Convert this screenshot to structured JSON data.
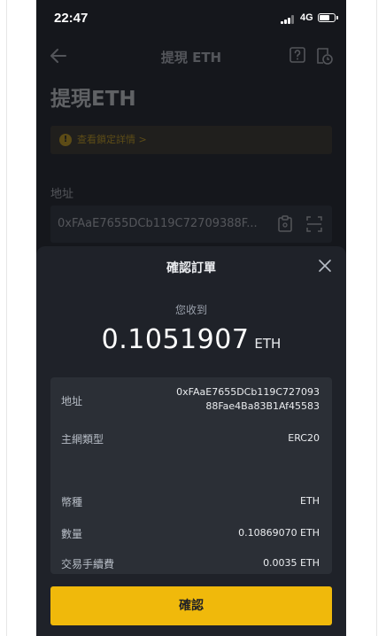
{
  "status_bar": {
    "time": "22:47",
    "network": "4G"
  },
  "background_screen": {
    "nav_title": "提現 ETH",
    "heading": "提現ETH",
    "notice": "查看鎖定詳情 >",
    "address_label": "地址",
    "address_value": "0xFAaE7655DCb119C72709388F..."
  },
  "confirm_sheet": {
    "title": "確認訂單",
    "receive_label": "您收到",
    "amount": "0.1051907",
    "unit": "ETH",
    "details": {
      "address_label": "地址",
      "address_line1": "0xFAaE7655DCb119C727093",
      "address_line2": "88Fae4Ba83B1Af45583",
      "network_label": "主網類型",
      "network_value": "ERC20",
      "coin_label": "幣種",
      "coin_value": "ETH",
      "quantity_label": "數量",
      "quantity_value": "0.10869070 ETH",
      "fee_label": "交易手續費",
      "fee_value": "0.0035 ETH"
    },
    "confirm_label": "確認"
  },
  "colors": {
    "accent": "#f0b90b",
    "sheet_bg": "#1f2229",
    "card_bg": "#2b2f36"
  },
  "icons": {
    "back": "arrow-left-icon",
    "help": "help-icon",
    "history": "history-icon",
    "paste": "paste-icon",
    "scan": "scan-icon",
    "close": "close-icon"
  }
}
